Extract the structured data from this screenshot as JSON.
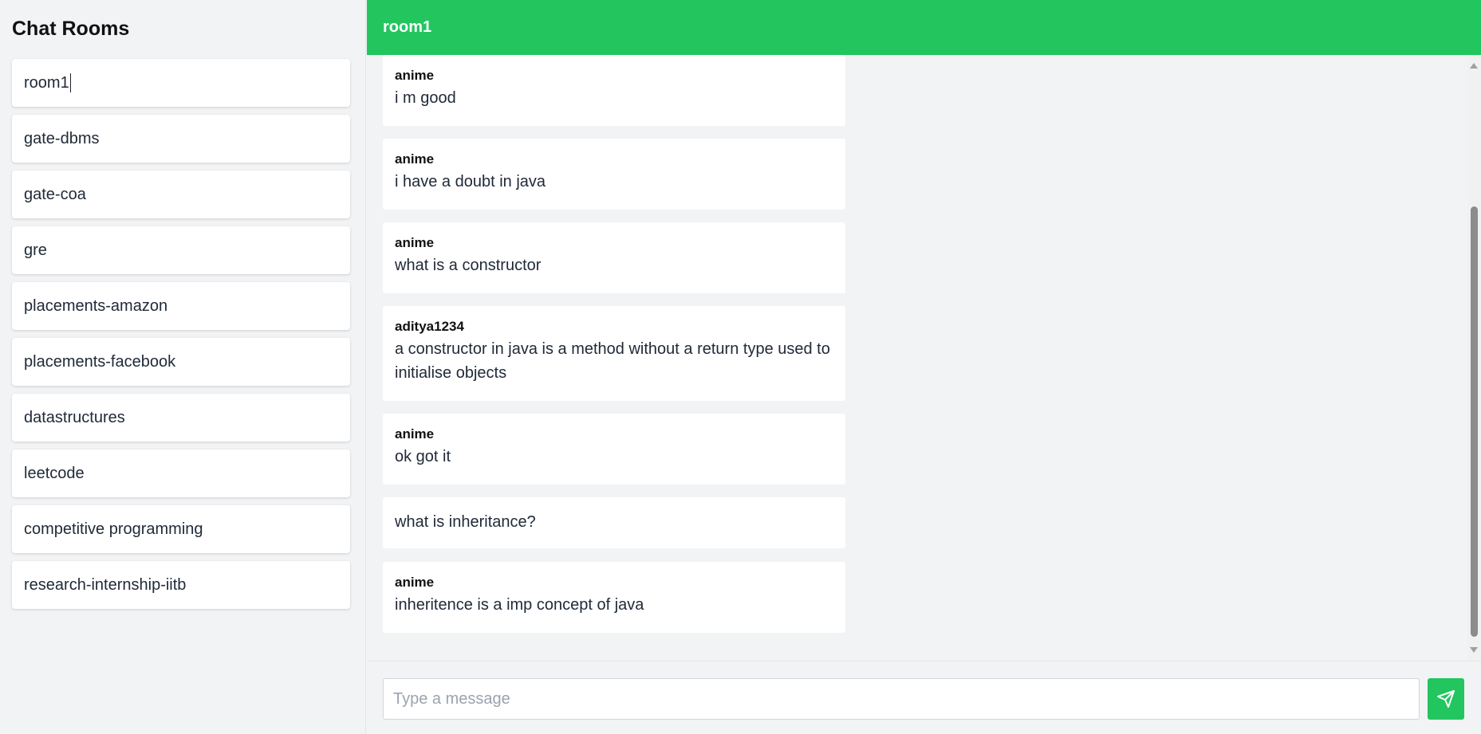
{
  "sidebar": {
    "title": "Chat Rooms",
    "rooms": [
      "room1",
      "gate-dbms",
      "gate-coa",
      "gre",
      "placements-amazon",
      "placements-facebook",
      "datastructures",
      "leetcode",
      "competitive programming",
      "research-internship-iitb"
    ],
    "active_room": "room1"
  },
  "header": {
    "title": "room1"
  },
  "messages": [
    {
      "user": "anime",
      "text": "i m good"
    },
    {
      "user": "anime",
      "text": "i have a doubt in java"
    },
    {
      "user": "anime",
      "text": "what is a constructor"
    },
    {
      "user": "aditya1234",
      "text": "a constructor in java is a method without a return type used to initialise objects"
    },
    {
      "user": "anime",
      "text": "ok got it"
    },
    {
      "user": "",
      "text": "what is inheritance?"
    },
    {
      "user": "anime",
      "text": "inheritence is a imp concept of java"
    }
  ],
  "composer": {
    "placeholder": "Type a message",
    "value": ""
  },
  "colors": {
    "accent": "#22c55e",
    "background": "#f2f3f5",
    "card": "#ffffff"
  },
  "icons": {
    "send": "send-icon"
  }
}
